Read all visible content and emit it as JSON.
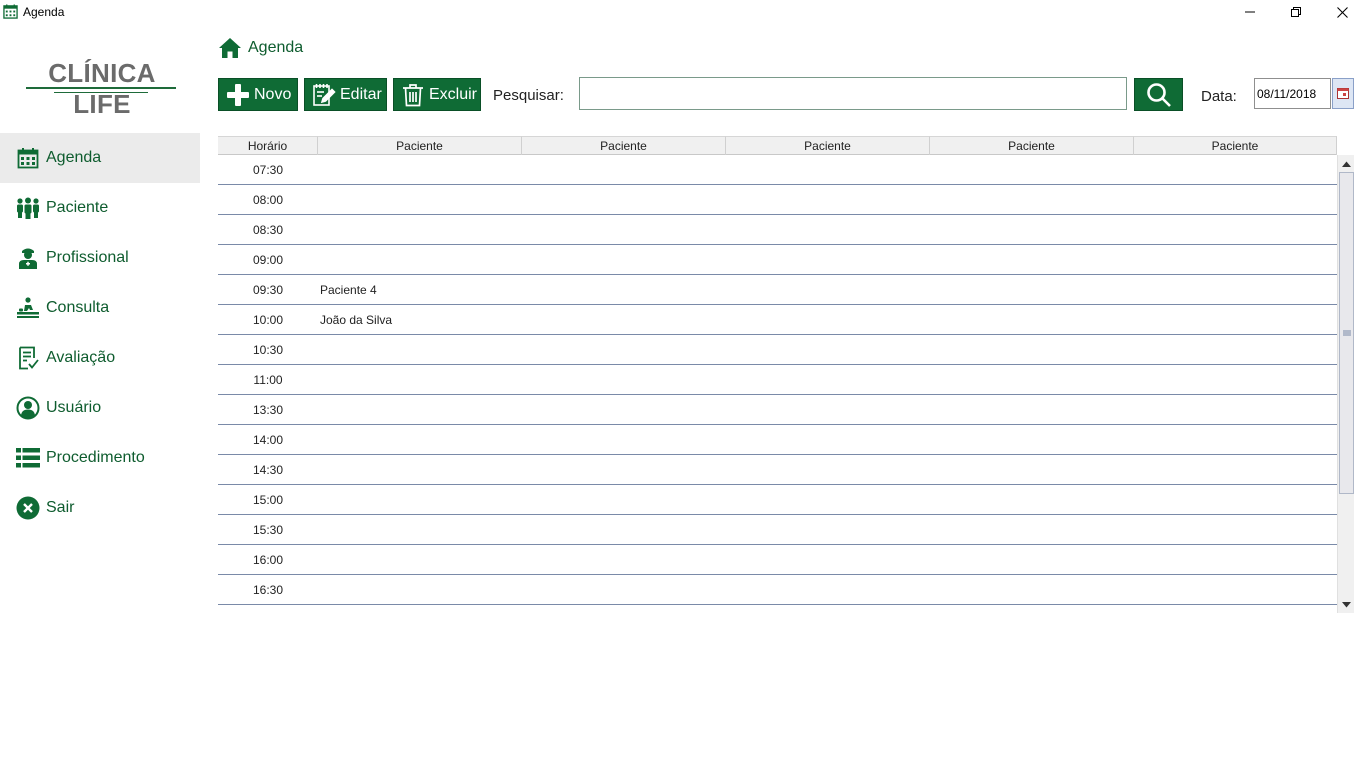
{
  "window": {
    "title": "Agenda",
    "minimize_icon": "minimize-icon",
    "restore_icon": "restore-icon",
    "close_icon": "close-icon"
  },
  "logo": {
    "text": "CLÍNICA LIFE"
  },
  "sidebar": {
    "items": [
      {
        "label": "Agenda",
        "icon": "calendar-icon",
        "active": true
      },
      {
        "label": "Paciente",
        "icon": "people-icon"
      },
      {
        "label": "Profissional",
        "icon": "doctor-icon"
      },
      {
        "label": "Consulta",
        "icon": "consultation-icon"
      },
      {
        "label": "Avaliação",
        "icon": "evaluation-icon"
      },
      {
        "label": "Usuário",
        "icon": "user-icon"
      },
      {
        "label": "Procedimento",
        "icon": "list-icon"
      },
      {
        "label": "Sair",
        "icon": "exit-icon"
      }
    ]
  },
  "breadcrumb": {
    "label": "Agenda",
    "icon": "home-icon"
  },
  "toolbar": {
    "novo_label": "Novo",
    "editar_label": "Editar",
    "excluir_label": "Excluir",
    "search_label": "Pesquisar:",
    "search_value": "",
    "date_label": "Data:",
    "date_value": "08/11/2018"
  },
  "grid": {
    "columns": [
      "Horário",
      "Paciente",
      "Paciente",
      "Paciente",
      "Paciente",
      "Paciente"
    ],
    "rows": [
      {
        "time": "07:30",
        "patients": [
          "",
          "",
          "",
          "",
          ""
        ]
      },
      {
        "time": "08:00",
        "patients": [
          "",
          "",
          "",
          "",
          ""
        ]
      },
      {
        "time": "08:30",
        "patients": [
          "",
          "",
          "",
          "",
          ""
        ]
      },
      {
        "time": "09:00",
        "patients": [
          "",
          "",
          "",
          "",
          ""
        ]
      },
      {
        "time": "09:30",
        "patients": [
          "Paciente 4",
          "",
          "",
          "",
          ""
        ]
      },
      {
        "time": "10:00",
        "patients": [
          "João da Silva",
          "",
          "",
          "",
          ""
        ]
      },
      {
        "time": "10:30",
        "patients": [
          "",
          "",
          "",
          "",
          ""
        ]
      },
      {
        "time": "11:00",
        "patients": [
          "",
          "",
          "",
          "",
          ""
        ]
      },
      {
        "time": "13:30",
        "patients": [
          "",
          "",
          "",
          "",
          ""
        ]
      },
      {
        "time": "14:00",
        "patients": [
          "",
          "",
          "",
          "",
          ""
        ]
      },
      {
        "time": "14:30",
        "patients": [
          "",
          "",
          "",
          "",
          ""
        ]
      },
      {
        "time": "15:00",
        "patients": [
          "",
          "",
          "",
          "",
          ""
        ]
      },
      {
        "time": "15:30",
        "patients": [
          "",
          "",
          "",
          "",
          ""
        ]
      },
      {
        "time": "16:00",
        "patients": [
          "",
          "",
          "",
          "",
          ""
        ]
      },
      {
        "time": "16:30",
        "patients": [
          "",
          "",
          "",
          "",
          ""
        ]
      }
    ]
  },
  "colors": {
    "accent": "#0f6b35",
    "text_accent": "#0e5c2e",
    "active_bg": "#ebebeb"
  }
}
